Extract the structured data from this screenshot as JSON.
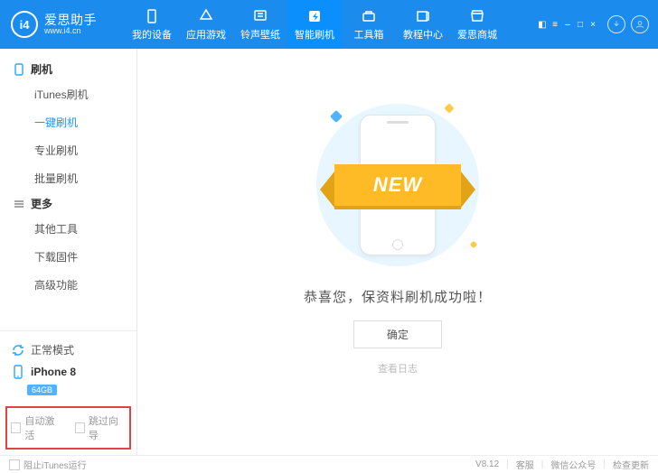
{
  "brand": {
    "name": "爱思助手",
    "url": "www.i4.cn",
    "logo_text": "i4"
  },
  "nav": {
    "items": [
      {
        "label": "我的设备",
        "icon": "device"
      },
      {
        "label": "应用游戏",
        "icon": "apps"
      },
      {
        "label": "铃声壁纸",
        "icon": "ringtone"
      },
      {
        "label": "智能刷机",
        "icon": "flash",
        "active": true
      },
      {
        "label": "工具箱",
        "icon": "toolbox"
      },
      {
        "label": "教程中心",
        "icon": "tutorial"
      },
      {
        "label": "爱思商城",
        "icon": "store"
      }
    ]
  },
  "sidebar": {
    "groups": [
      {
        "title": "刷机",
        "icon": "phone",
        "items": [
          {
            "label": "iTunes刷机"
          },
          {
            "label": "一键刷机",
            "active": true
          },
          {
            "label": "专业刷机"
          },
          {
            "label": "批量刷机"
          }
        ]
      },
      {
        "title": "更多",
        "icon": "more",
        "items": [
          {
            "label": "其他工具"
          },
          {
            "label": "下载固件"
          },
          {
            "label": "高级功能"
          }
        ]
      }
    ],
    "mode": {
      "label": "正常模式"
    },
    "device": {
      "name": "iPhone 8",
      "storage": "64GB"
    },
    "checks": [
      {
        "label": "自动激活"
      },
      {
        "label": "跳过向导"
      }
    ]
  },
  "main": {
    "ribbon": "NEW",
    "success": "恭喜您，保资料刷机成功啦！",
    "confirm": "确定",
    "view_log": "查看日志"
  },
  "footer": {
    "block_itunes": "阻止iTunes运行",
    "version": "V8.12",
    "links": [
      "客服",
      "微信公众号",
      "检查更新"
    ]
  }
}
